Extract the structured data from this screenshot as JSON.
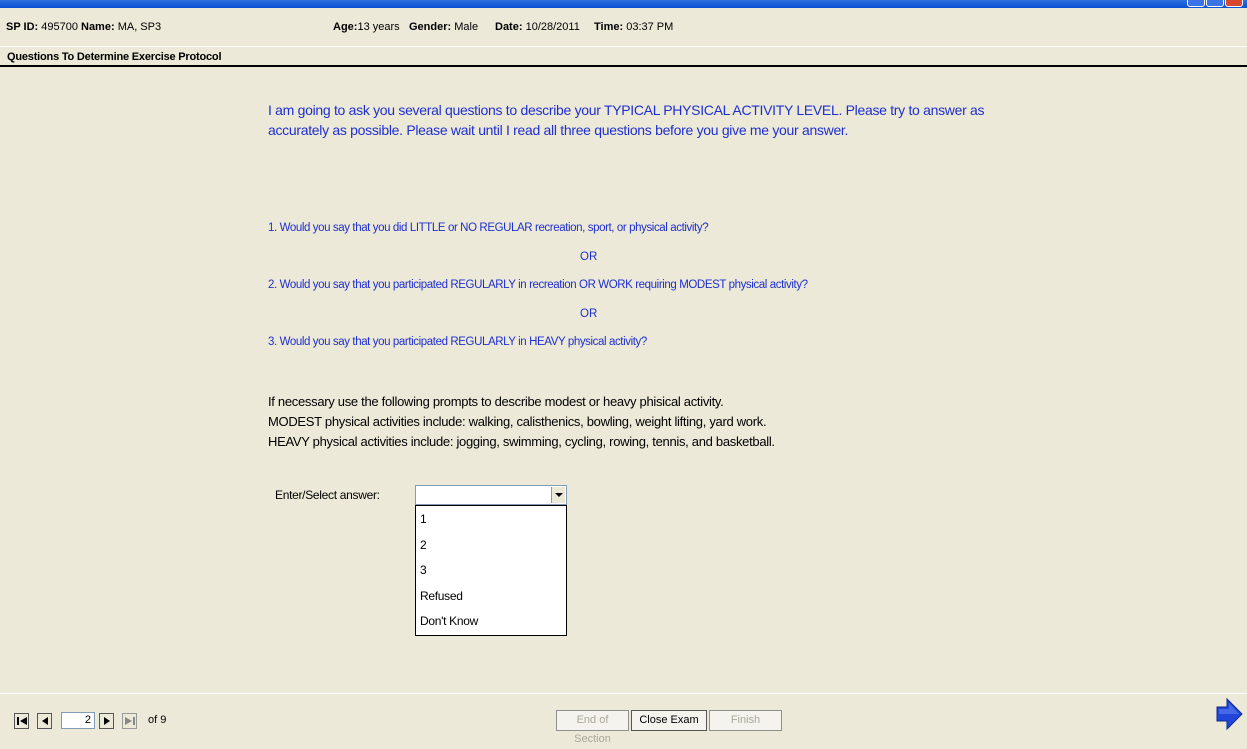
{
  "header": {
    "sp_id_label": "SP ID:",
    "sp_id": "495700",
    "name_label": "Name:",
    "name": "MA, SP3",
    "age_label": "Age:",
    "age": "13 years",
    "gender_label": "Gender:",
    "gender": "Male",
    "date_label": "Date:",
    "date": "10/28/2011",
    "time_label": "Time:",
    "time": "03:37 PM"
  },
  "section": {
    "title": "Questions To Determine Exercise Protocol"
  },
  "intro": "I am going to ask you several questions to describe your TYPICAL PHYSICAL ACTIVITY LEVEL. Please try to answer as accurately as possible. Please wait until I read all three questions before you give me your answer.",
  "questions": [
    "1. Would you say that you did LITTLE or NO REGULAR recreation, sport, or physical activity?",
    "2. Would you say that you participated REGULARLY in recreation OR WORK requiring MODEST physical activity?",
    "3. Would you say that you participated REGULARLY in HEAVY physical activity?"
  ],
  "or_label": "OR",
  "prompts": [
    "If necessary use the following prompts to describe modest or heavy phisical activity.",
    "MODEST physical activities include: walking, calisthenics, bowling, weight lifting, yard work.",
    "HEAVY physical activities include: jogging, swimming, cycling, rowing, tennis, and basketball."
  ],
  "answer": {
    "label": "Enter/Select answer:",
    "value": "",
    "options": [
      "1",
      "2",
      "3",
      "Refused",
      "Don't Know"
    ]
  },
  "footer": {
    "page": "2",
    "of_label": "of 9",
    "end_of_section": "End of Section",
    "close_exam": "Close Exam",
    "finish": "Finish"
  },
  "colors": {
    "accent_blue": "#1F2FCF",
    "background": "#ECE9D8"
  }
}
